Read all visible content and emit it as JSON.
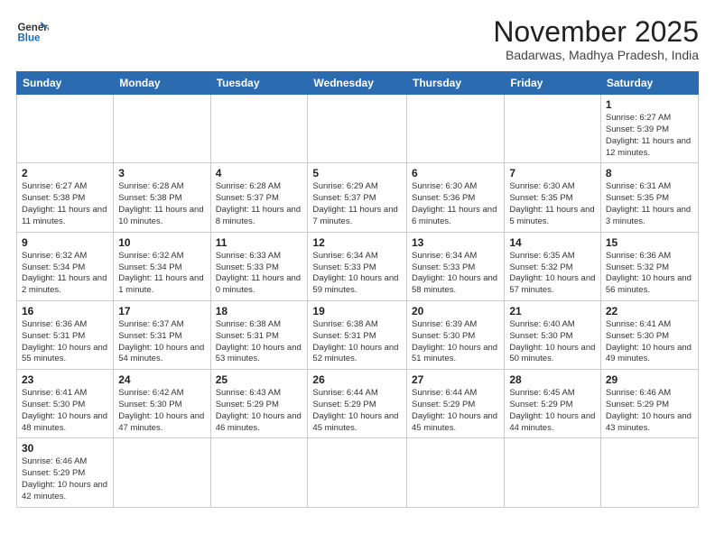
{
  "header": {
    "logo_text_1": "General",
    "logo_text_2": "Blue",
    "month_title": "November 2025",
    "subtitle": "Badarwas, Madhya Pradesh, India"
  },
  "days_of_week": [
    "Sunday",
    "Monday",
    "Tuesday",
    "Wednesday",
    "Thursday",
    "Friday",
    "Saturday"
  ],
  "weeks": [
    [
      {
        "day": "",
        "info": ""
      },
      {
        "day": "",
        "info": ""
      },
      {
        "day": "",
        "info": ""
      },
      {
        "day": "",
        "info": ""
      },
      {
        "day": "",
        "info": ""
      },
      {
        "day": "",
        "info": ""
      },
      {
        "day": "1",
        "info": "Sunrise: 6:27 AM\nSunset: 5:39 PM\nDaylight: 11 hours and 12 minutes."
      }
    ],
    [
      {
        "day": "2",
        "info": "Sunrise: 6:27 AM\nSunset: 5:38 PM\nDaylight: 11 hours and 11 minutes."
      },
      {
        "day": "3",
        "info": "Sunrise: 6:28 AM\nSunset: 5:38 PM\nDaylight: 11 hours and 10 minutes."
      },
      {
        "day": "4",
        "info": "Sunrise: 6:28 AM\nSunset: 5:37 PM\nDaylight: 11 hours and 8 minutes."
      },
      {
        "day": "5",
        "info": "Sunrise: 6:29 AM\nSunset: 5:37 PM\nDaylight: 11 hours and 7 minutes."
      },
      {
        "day": "6",
        "info": "Sunrise: 6:30 AM\nSunset: 5:36 PM\nDaylight: 11 hours and 6 minutes."
      },
      {
        "day": "7",
        "info": "Sunrise: 6:30 AM\nSunset: 5:35 PM\nDaylight: 11 hours and 5 minutes."
      },
      {
        "day": "8",
        "info": "Sunrise: 6:31 AM\nSunset: 5:35 PM\nDaylight: 11 hours and 3 minutes."
      }
    ],
    [
      {
        "day": "9",
        "info": "Sunrise: 6:32 AM\nSunset: 5:34 PM\nDaylight: 11 hours and 2 minutes."
      },
      {
        "day": "10",
        "info": "Sunrise: 6:32 AM\nSunset: 5:34 PM\nDaylight: 11 hours and 1 minute."
      },
      {
        "day": "11",
        "info": "Sunrise: 6:33 AM\nSunset: 5:33 PM\nDaylight: 11 hours and 0 minutes."
      },
      {
        "day": "12",
        "info": "Sunrise: 6:34 AM\nSunset: 5:33 PM\nDaylight: 10 hours and 59 minutes."
      },
      {
        "day": "13",
        "info": "Sunrise: 6:34 AM\nSunset: 5:33 PM\nDaylight: 10 hours and 58 minutes."
      },
      {
        "day": "14",
        "info": "Sunrise: 6:35 AM\nSunset: 5:32 PM\nDaylight: 10 hours and 57 minutes."
      },
      {
        "day": "15",
        "info": "Sunrise: 6:36 AM\nSunset: 5:32 PM\nDaylight: 10 hours and 56 minutes."
      }
    ],
    [
      {
        "day": "16",
        "info": "Sunrise: 6:36 AM\nSunset: 5:31 PM\nDaylight: 10 hours and 55 minutes."
      },
      {
        "day": "17",
        "info": "Sunrise: 6:37 AM\nSunset: 5:31 PM\nDaylight: 10 hours and 54 minutes."
      },
      {
        "day": "18",
        "info": "Sunrise: 6:38 AM\nSunset: 5:31 PM\nDaylight: 10 hours and 53 minutes."
      },
      {
        "day": "19",
        "info": "Sunrise: 6:38 AM\nSunset: 5:31 PM\nDaylight: 10 hours and 52 minutes."
      },
      {
        "day": "20",
        "info": "Sunrise: 6:39 AM\nSunset: 5:30 PM\nDaylight: 10 hours and 51 minutes."
      },
      {
        "day": "21",
        "info": "Sunrise: 6:40 AM\nSunset: 5:30 PM\nDaylight: 10 hours and 50 minutes."
      },
      {
        "day": "22",
        "info": "Sunrise: 6:41 AM\nSunset: 5:30 PM\nDaylight: 10 hours and 49 minutes."
      }
    ],
    [
      {
        "day": "23",
        "info": "Sunrise: 6:41 AM\nSunset: 5:30 PM\nDaylight: 10 hours and 48 minutes."
      },
      {
        "day": "24",
        "info": "Sunrise: 6:42 AM\nSunset: 5:30 PM\nDaylight: 10 hours and 47 minutes."
      },
      {
        "day": "25",
        "info": "Sunrise: 6:43 AM\nSunset: 5:29 PM\nDaylight: 10 hours and 46 minutes."
      },
      {
        "day": "26",
        "info": "Sunrise: 6:44 AM\nSunset: 5:29 PM\nDaylight: 10 hours and 45 minutes."
      },
      {
        "day": "27",
        "info": "Sunrise: 6:44 AM\nSunset: 5:29 PM\nDaylight: 10 hours and 45 minutes."
      },
      {
        "day": "28",
        "info": "Sunrise: 6:45 AM\nSunset: 5:29 PM\nDaylight: 10 hours and 44 minutes."
      },
      {
        "day": "29",
        "info": "Sunrise: 6:46 AM\nSunset: 5:29 PM\nDaylight: 10 hours and 43 minutes."
      }
    ],
    [
      {
        "day": "30",
        "info": "Sunrise: 6:46 AM\nSunset: 5:29 PM\nDaylight: 10 hours and 42 minutes."
      },
      {
        "day": "",
        "info": ""
      },
      {
        "day": "",
        "info": ""
      },
      {
        "day": "",
        "info": ""
      },
      {
        "day": "",
        "info": ""
      },
      {
        "day": "",
        "info": ""
      },
      {
        "day": "",
        "info": ""
      }
    ]
  ]
}
